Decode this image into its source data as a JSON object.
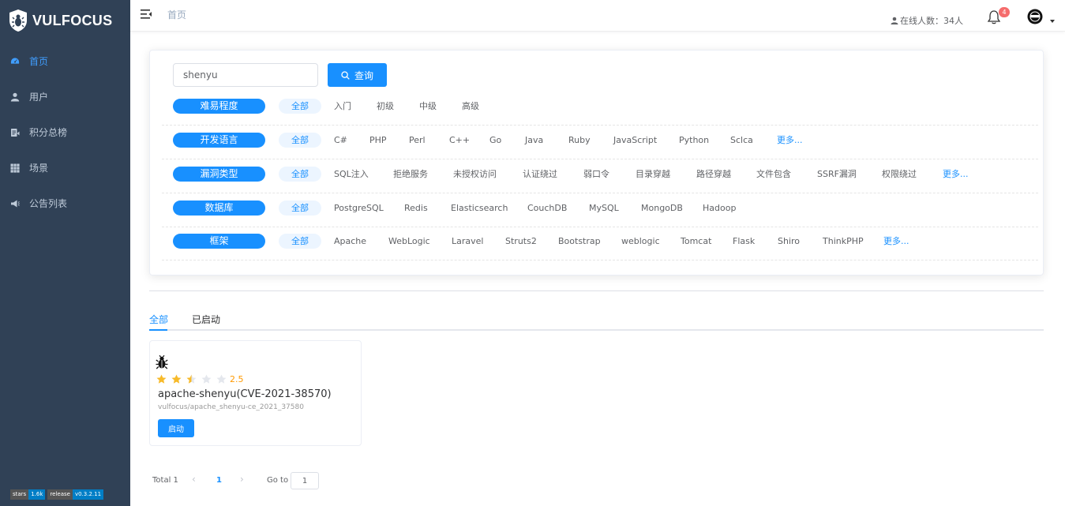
{
  "app": {
    "title": "VULFOCUS"
  },
  "sidebar": {
    "items": [
      {
        "label": "首页",
        "icon": "dashboard-icon",
        "active": true
      },
      {
        "label": "用户",
        "icon": "user-icon"
      },
      {
        "label": "积分总榜",
        "icon": "ranking-icon"
      },
      {
        "label": "场景",
        "icon": "grid-icon"
      },
      {
        "label": "公告列表",
        "icon": "megaphone-icon"
      }
    ],
    "badges": [
      {
        "left": "stars",
        "right": "1.6k"
      },
      {
        "left": "release",
        "right": "v0.3.2.11"
      }
    ]
  },
  "header": {
    "breadcrumb": "首页",
    "online": "在线人数：34人",
    "notification_count": "4"
  },
  "search": {
    "value": "shenyu",
    "button_label": "查询"
  },
  "filters": [
    {
      "category": "难易程度",
      "all": "全部",
      "options": [
        "入门",
        "初级",
        "中级",
        "高级"
      ],
      "more": ""
    },
    {
      "category": "开发语言",
      "all": "全部",
      "options": [
        "C#",
        "PHP",
        "Perl",
        "C++",
        "Go",
        "Java",
        "Ruby",
        "JavaScript",
        "Python",
        "Sclca"
      ],
      "more": "更多..."
    },
    {
      "category": "漏洞类型",
      "all": "全部",
      "options": [
        "SQL注入",
        "拒绝服务",
        "未授权访问",
        "认证绕过",
        "弱口令",
        "目录穿越",
        "路径穿越",
        "文件包含",
        "SSRF漏洞",
        "权限绕过"
      ],
      "more": "更多..."
    },
    {
      "category": "数据库",
      "all": "全部",
      "options": [
        "PostgreSQL",
        "Redis",
        "Elasticsearch",
        "CouchDB",
        "MySQL",
        "MongoDB",
        "Hadoop"
      ],
      "more": ""
    },
    {
      "category": "框架",
      "all": "全部",
      "options": [
        "Apache",
        "WebLogic",
        "Laravel",
        "Struts2",
        "Bootstrap",
        "weblogic",
        "Tomcat",
        "Flask",
        "Shiro",
        "ThinkPHP"
      ],
      "more": "更多..."
    }
  ],
  "tabs": [
    {
      "label": "全部",
      "active": true
    },
    {
      "label": "已启动",
      "active": false
    }
  ],
  "cards": [
    {
      "rating": 2.5,
      "rating_text": "2.5",
      "title": "apache-shenyu(CVE-2021-38570)",
      "image": "vulfocus/apache_shenyu-ce_2021_37580",
      "button": "启动"
    }
  ],
  "pagination": {
    "total_label": "Total 1",
    "current_page": "1",
    "goto_label": "Go to",
    "goto_value": "1"
  },
  "colors": {
    "sidebar_bg": "#304156",
    "accent": "#1890ff",
    "star": "#f7ba2a",
    "badge_red": "#f56c6c"
  }
}
